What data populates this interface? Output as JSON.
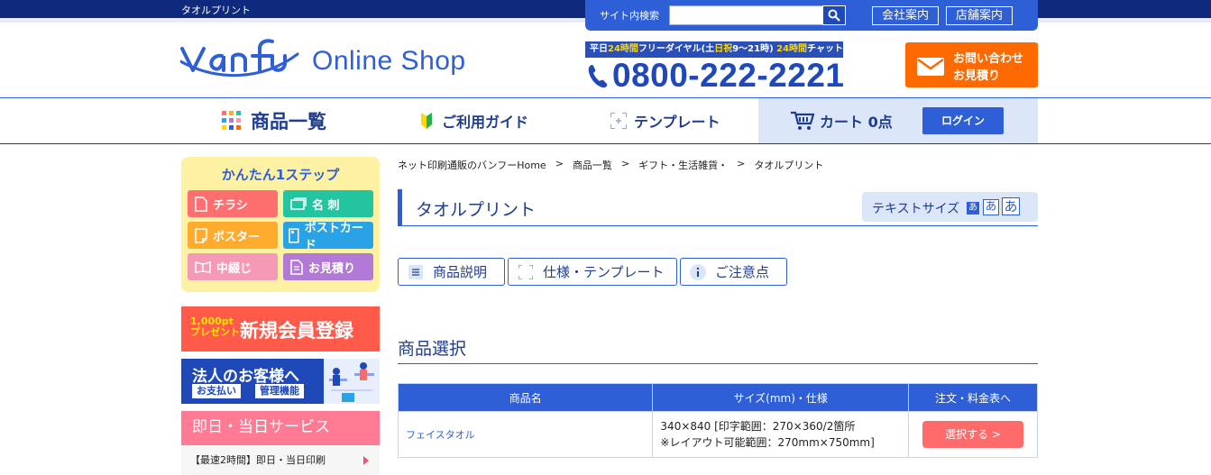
{
  "header": {
    "strip_title": "タオルプリント",
    "search_label": "サイト内検索",
    "search_value": "",
    "company_link": "会社案内",
    "store_link": "店舗案内",
    "logo_text": "Vanfu",
    "shop_name": "Online Shop",
    "phone_tag_1": "平日",
    "phone_tag_2": "24時間",
    "phone_tag_3": "フリーダイヤル(土",
    "phone_tag_4": "日祝",
    "phone_tag_5": "9〜21時)",
    "phone_tag_6": "24時間",
    "phone_tag_7": "チャット",
    "phone_number": "0800-222-2221",
    "contact_line1": "お問い合わせ",
    "contact_line2": "お見積り"
  },
  "nav": {
    "products": "商品一覧",
    "guide": "ご利用ガイド",
    "template": "テンプレート",
    "cart": "カート 0点",
    "login": "ログイン"
  },
  "sidebar": {
    "step_title": "かんたん1ステップ",
    "steps": [
      {
        "label": "チラシ",
        "color": "#ff6f6f"
      },
      {
        "label": "名 刺",
        "color": "#22c5a0"
      },
      {
        "label": "ポスター",
        "color": "#ffab2e"
      },
      {
        "label": "ポストカード",
        "color": "#2aa3e6"
      },
      {
        "label": "中綴じ",
        "color": "#f59ab6"
      },
      {
        "label": "お見積り",
        "color": "#b27ad6"
      }
    ],
    "reg_pt_1": "1,000pt",
    "reg_pt_2": "プレゼント",
    "reg_big": "新規会員登録",
    "corp_title": "法人のお客様へ",
    "corp_tag1": "お支払い",
    "corp_tag2": "管理機能",
    "sameday_head": "即日・当日サービス",
    "sameday_link": "【最速2時間】即日・当日印刷"
  },
  "main": {
    "breadcrumb": [
      "ネット印刷通販のバンフーHome",
      "商品一覧",
      "ギフト・生活雑貨・",
      "タオルプリント"
    ],
    "breadcrumb_sep": ">",
    "title": "タオルプリント",
    "textsize_label": "テキストサイズ",
    "textsize_options": [
      "あ",
      "あ",
      "あ"
    ],
    "tabs": [
      "商品説明",
      "仕様・テンプレート",
      "ご注意点"
    ],
    "section_title": "商品選択",
    "table": {
      "headers": [
        "商品名",
        "サイズ(mm)・仕様",
        "注文・料金表へ"
      ],
      "rows": [
        {
          "name": "フェイスタオル",
          "spec_line1": "340×840 [印字範囲：270×360/2箇所",
          "spec_line2": "※レイアウト可能範囲：270mm×750mm]",
          "action": "選択する >"
        }
      ]
    }
  },
  "colors": {
    "brand_blue": "#2e5fd6",
    "dark_navy": "#0f2a7c",
    "orange": "#ff6a00",
    "pink": "#ff7a93"
  }
}
